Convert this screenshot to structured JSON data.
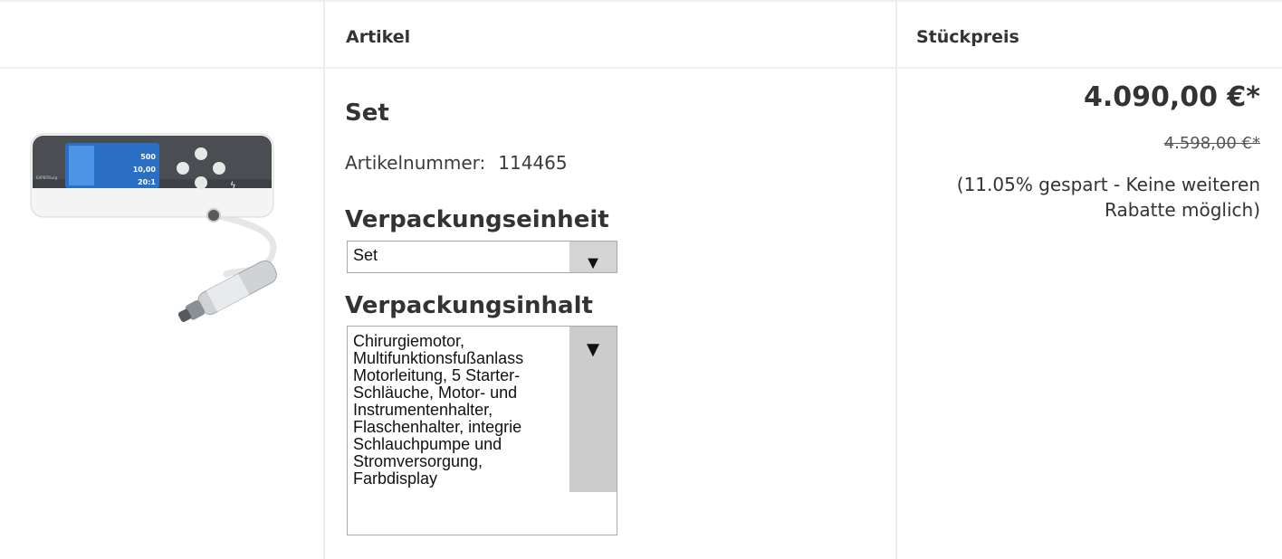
{
  "table": {
    "headers": {
      "article": "Artikel",
      "unit_price": "Stückpreis"
    }
  },
  "product": {
    "title": "Set",
    "article_number_label": "Artikelnummer:",
    "article_number": "114465",
    "image_text": {
      "screen_value_1": "500",
      "screen_value_2": "10,00",
      "screen_ratio": "20:1",
      "brand": "EXPERTsurg"
    }
  },
  "packaging_unit": {
    "heading": "Verpackungseinheit",
    "selected": "Set",
    "arrow": "▼"
  },
  "packaging_content": {
    "heading": "Verpackungsinhalt",
    "selected_lines": "Chirurgiemotor,\nMultifunktionsfußanlass\nMotorleitung, 5 Starter-\nSchläuche, Motor- und\nInstrumentenhalter,\nFlaschenhalter, integrie\nSchlauchpumpe und\nStromversorgung,\nFarbdisplay",
    "arrow": "▼"
  },
  "pricing": {
    "price": "4.090,00 €*",
    "old_price": "4.598,00 €*",
    "savings_note": "(11.05% gespart - Keine weiteren Rabatte möglich)"
  }
}
